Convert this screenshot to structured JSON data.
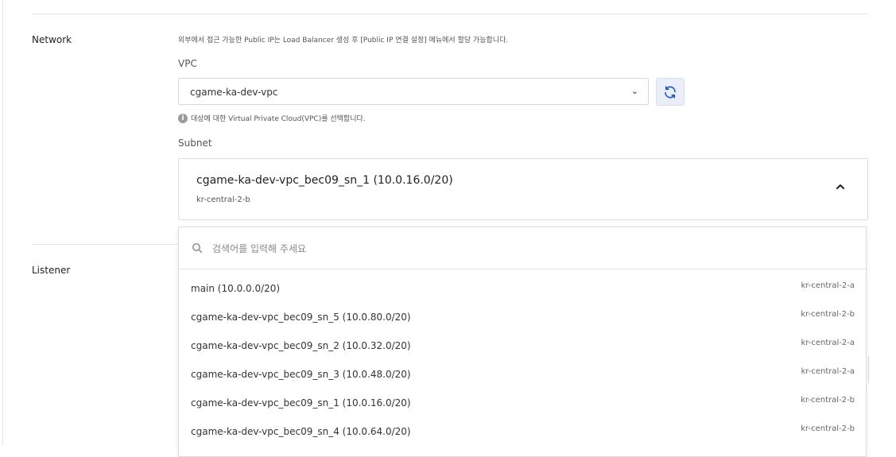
{
  "network": {
    "section_label": "Network",
    "notice": "외부에서 접근 가능한 Public IP는 Load Balancer 생성 후 [Public IP 연결 설정] 메뉴에서 할당 가능합니다.",
    "vpc": {
      "label": "VPC",
      "selected": "cgame-ka-dev-vpc",
      "hint": "대상에 대한 Virtual Private Cloud(VPC)를 선택합니다.",
      "refresh_icon": "refresh-icon"
    },
    "subnet": {
      "label": "Subnet",
      "selected_name": "cgame-ka-dev-vpc_bec09_sn_1 (10.0.16.0/20)",
      "selected_zone": "kr-central-2-b",
      "search_placeholder": "검색어를 입력해 주세요",
      "options": [
        {
          "label": "main (10.0.0.0/20)",
          "zone": "kr-central-2-a"
        },
        {
          "label": "cgame-ka-dev-vpc_bec09_sn_5 (10.0.80.0/20)",
          "zone": "kr-central-2-b"
        },
        {
          "label": "cgame-ka-dev-vpc_bec09_sn_2 (10.0.32.0/20)",
          "zone": "kr-central-2-a"
        },
        {
          "label": "cgame-ka-dev-vpc_bec09_sn_3 (10.0.48.0/20)",
          "zone": "kr-central-2-a"
        },
        {
          "label": "cgame-ka-dev-vpc_bec09_sn_1 (10.0.16.0/20)",
          "zone": "kr-central-2-b"
        },
        {
          "label": "cgame-ka-dev-vpc_bec09_sn_4 (10.0.64.0/20)",
          "zone": "kr-central-2-b"
        }
      ]
    }
  },
  "listener": {
    "section_label": "Listener"
  },
  "colors": {
    "accent": "#1a56c4",
    "refresh_bg": "#e9eef9",
    "border": "#dcdcdc"
  }
}
